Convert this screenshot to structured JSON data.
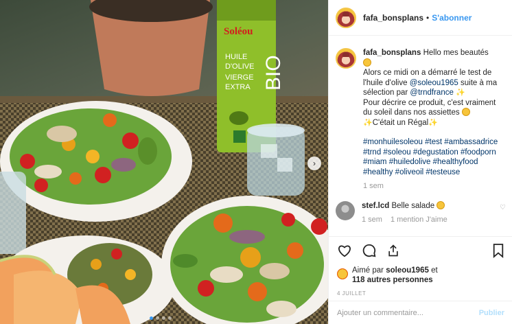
{
  "post": {
    "username": "fafa_bonsplans",
    "separator": "•",
    "follow_label": "S'abonner"
  },
  "photo": {
    "product_brand": "Soléou",
    "product_text_1": "HUILE",
    "product_text_2": "D'OLIVE",
    "product_text_3": "VIERGE",
    "product_text_4": "EXTRA",
    "product_bio": "BIO",
    "next_icon": "chevron-right-icon",
    "slide_count": 4,
    "active_slide": 1
  },
  "caption": {
    "username": "fafa_bonsplans",
    "greeting": "Hello mes beautés",
    "line1_a": "Alors ce midi on a démarré le test de l'huile d'olive ",
    "mention1": "@soleou1965",
    "line1_b": " suite à ma sélection par ",
    "mention2": "@trndfrance",
    "line2": "Pour décrire ce produit, c'est vraiment du soleil dans nos assiettes",
    "line3": "C'était un Régal",
    "hashtags": "#monhuilesoleou #test #ambassadrice #trnd #soleou #degustation #foodporn #miam #huiledolive #healthyfood #healthy #oliveoil #testeuse",
    "time": "1 sem"
  },
  "comment": {
    "username": "stef.lcd",
    "text": "Belle salade",
    "time": "1 sem",
    "likes": "1 mention J'aime"
  },
  "actions": {
    "liked_by_prefix": "Aimé par ",
    "liked_by_user": "soleou1965",
    "liked_by_suffix": " et",
    "others": "118 autres personnes",
    "date": "4 JUILLET"
  },
  "add_comment": {
    "placeholder": "Ajouter un commentaire...",
    "submit": "Publier"
  }
}
